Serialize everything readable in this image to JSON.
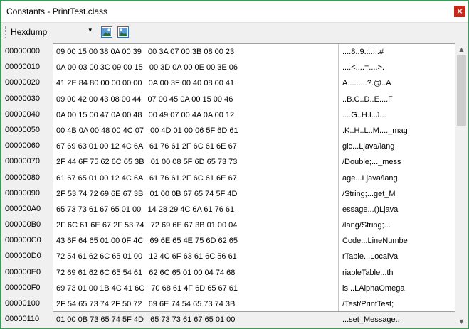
{
  "window": {
    "title": "Constants - PrintTest.class",
    "close_glyph": "×"
  },
  "toolbar": {
    "view_mode": "Hexdump",
    "dropdown_glyph": "▾",
    "buttons": [
      {
        "icon": "image-export-icon"
      },
      {
        "icon": "image-save-icon"
      }
    ]
  },
  "offsets": [
    "00000000",
    "00000010",
    "00000020",
    "00000030",
    "00000040",
    "00000050",
    "00000060",
    "00000070",
    "00000080",
    "00000090",
    "000000A0",
    "000000B0",
    "000000C0",
    "000000D0",
    "000000E0",
    "000000F0",
    "00000100",
    "00000110"
  ],
  "hex_rows": [
    "09 00 15 00 38 0A 00 39   00 3A 07 00 3B 08 00 23",
    "0A 00 03 00 3C 09 00 15   00 3D 0A 00 0E 00 3E 06",
    "41 2E 84 80 00 00 00 00   0A 00 3F 00 40 08 00 41",
    "09 00 42 00 43 08 00 44   07 00 45 0A 00 15 00 46",
    "0A 00 15 00 47 0A 00 48   00 49 07 00 4A 0A 00 12",
    "00 4B 0A 00 48 00 4C 07   00 4D 01 00 06 5F 6D 61",
    "67 69 63 01 00 12 4C 6A   61 76 61 2F 6C 61 6E 67",
    "2F 44 6F 75 62 6C 65 3B   01 00 08 5F 6D 65 73 73",
    "61 67 65 01 00 12 4C 6A   61 76 61 2F 6C 61 6E 67",
    "2F 53 74 72 69 6E 67 3B   01 00 0B 67 65 74 5F 4D",
    "65 73 73 61 67 65 01 00   14 28 29 4C 6A 61 76 61",
    "2F 6C 61 6E 67 2F 53 74   72 69 6E 67 3B 01 00 04",
    "43 6F 64 65 01 00 0F 4C   69 6E 65 4E 75 6D 62 65",
    "72 54 61 62 6C 65 01 00   12 4C 6F 63 61 6C 56 61",
    "72 69 61 62 6C 65 54 61   62 6C 65 01 00 04 74 68",
    "69 73 01 00 1B 4C 41 6C   70 68 61 4F 6D 65 67 61",
    "2F 54 65 73 74 2F 50 72   69 6E 74 54 65 73 74 3B",
    "01 00 0B 73 65 74 5F 4D   65 73 73 61 67 65 01 00"
  ],
  "ascii_rows": [
    "....8..9.:..;..#",
    "....<....=....>.",
    "A.........?.@..A",
    "..B.C..D..E....F",
    "....G..H.I..J...",
    ".K..H..L..M...._mag",
    "gic...Ljava/lang",
    "/Double;..._mess",
    "age...Ljava/lang",
    "/String;...get_M",
    "essage...()Ljava",
    "/lang/String;...",
    "Code...LineNumbe",
    "rTable...LocalVa",
    "riableTable...th",
    "is...LAlphaOmega",
    "/Test/PrintTest;",
    "...set_Message.."
  ],
  "scrollbar": {
    "up_glyph": "▲",
    "down_glyph": "▼"
  }
}
